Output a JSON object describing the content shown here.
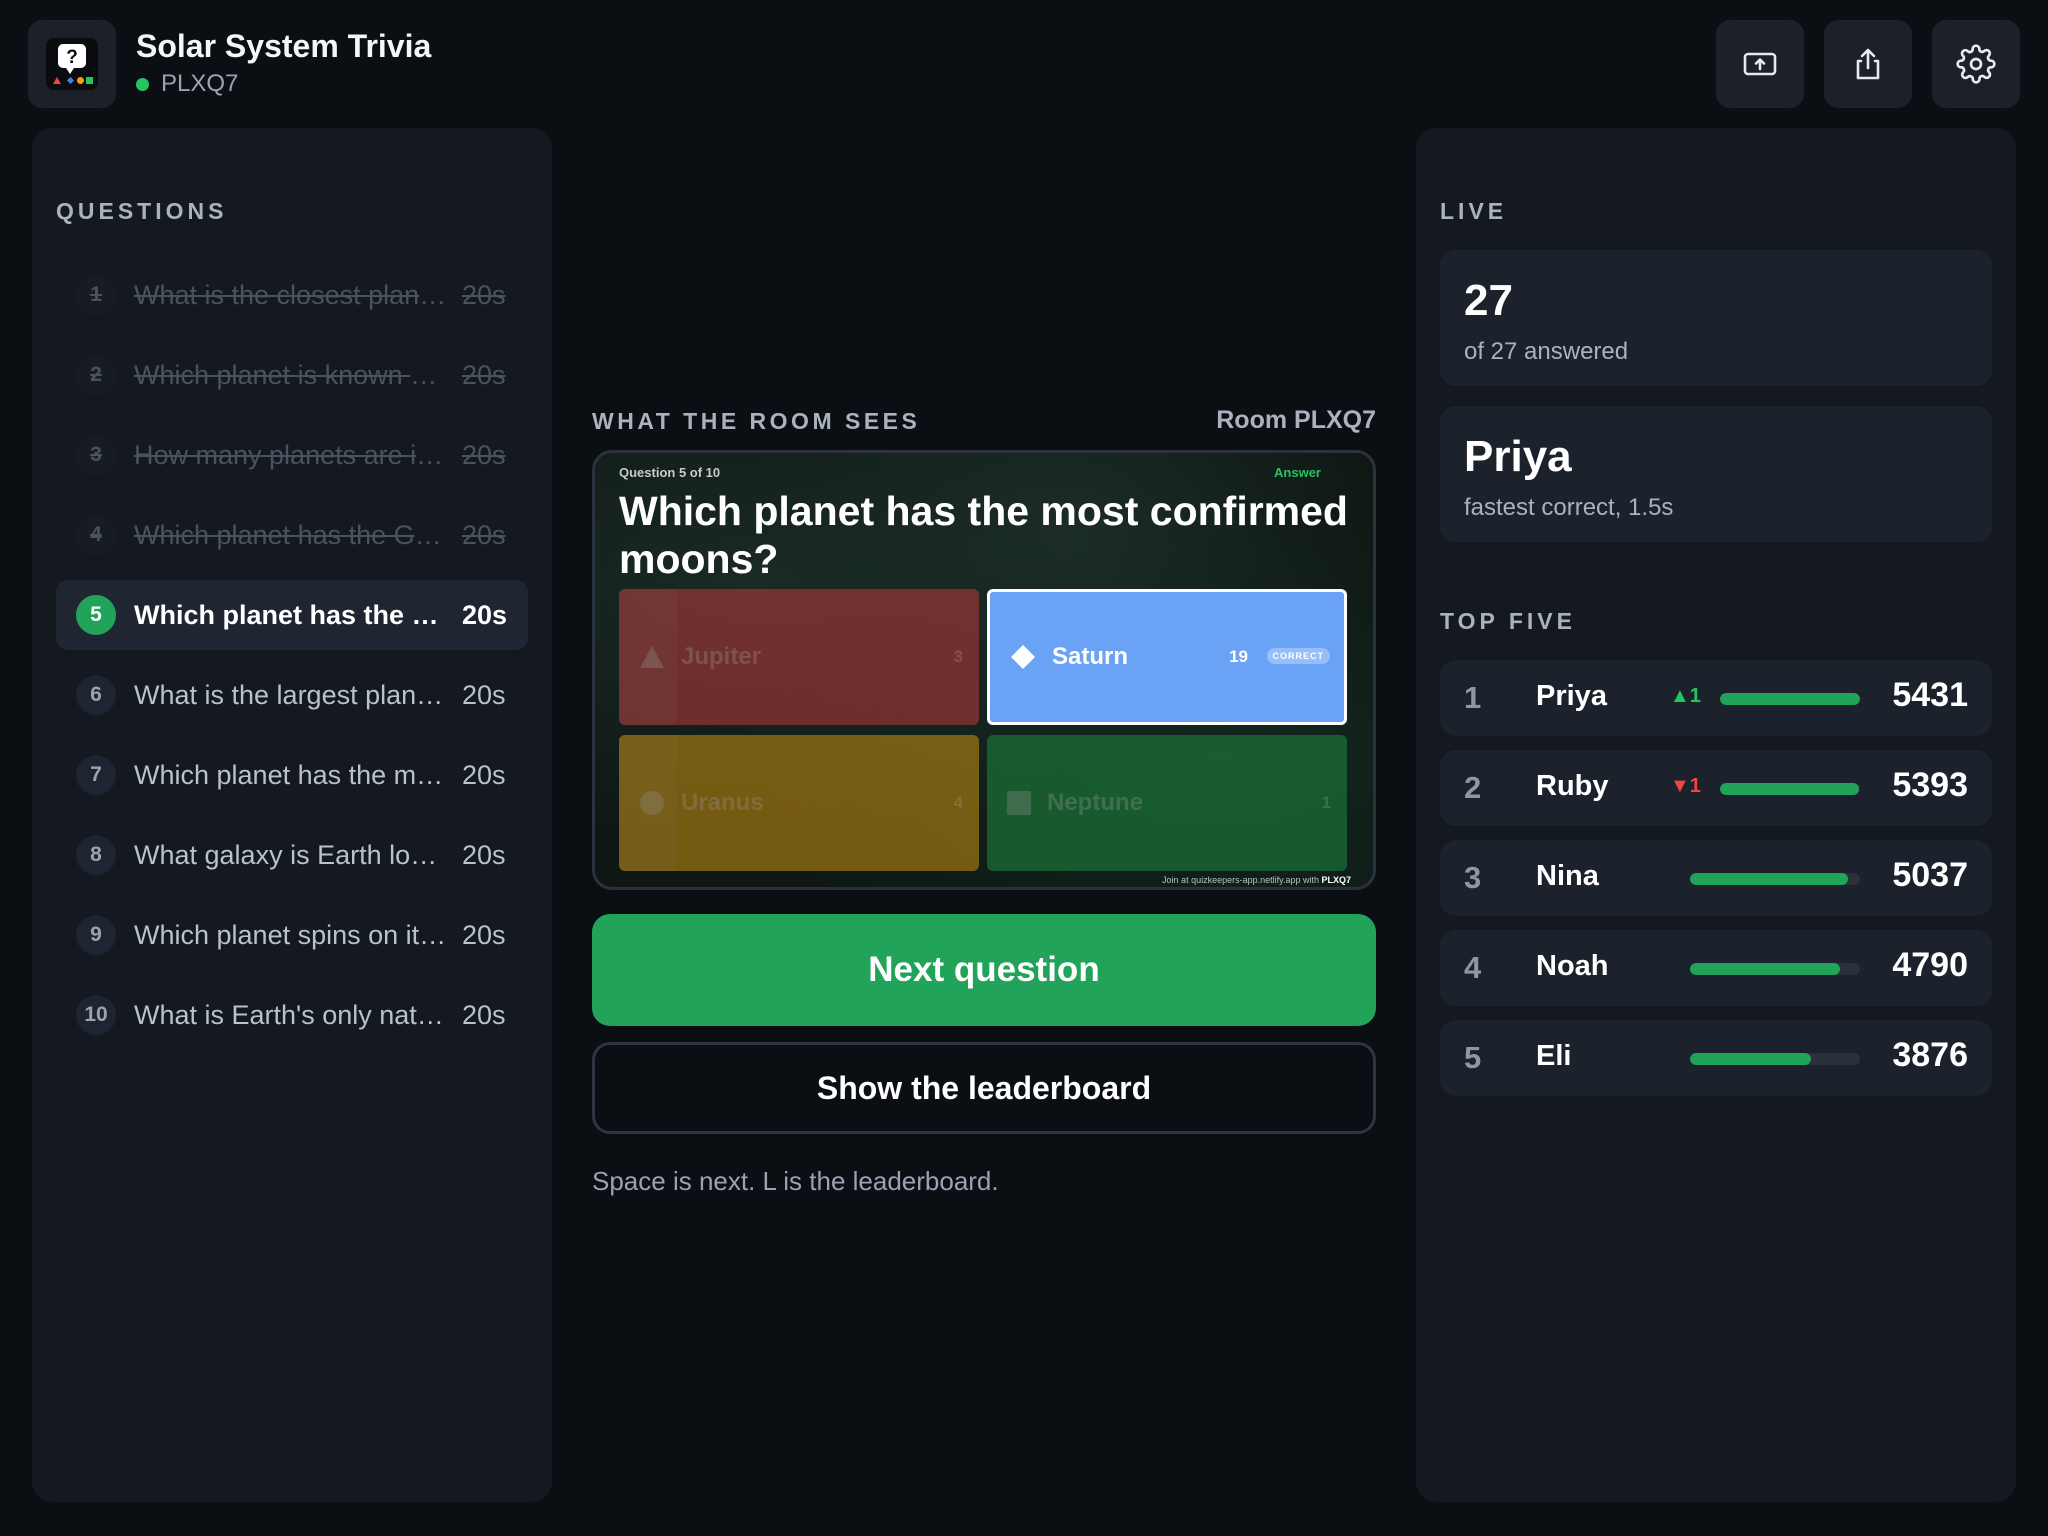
{
  "header": {
    "title": "Solar System Trivia",
    "room_code": "PLXQ7",
    "icons": [
      "cast-screen-icon",
      "share-icon",
      "settings-icon"
    ]
  },
  "questions": {
    "label": "QUESTIONS",
    "items": [
      {
        "num": "1",
        "text": "What is the closest planet to the Sun?",
        "time": "20s",
        "state": "done"
      },
      {
        "num": "2",
        "text": "Which planet is known as the Red Planet?",
        "time": "20s",
        "state": "done"
      },
      {
        "num": "3",
        "text": "How many planets are in our solar system?",
        "time": "20s",
        "state": "done"
      },
      {
        "num": "4",
        "text": "Which planet has the Great Red Spot?",
        "time": "20s",
        "state": "done"
      },
      {
        "num": "5",
        "text": "Which planet has the most confirmed moons?",
        "time": "20s",
        "state": "active"
      },
      {
        "num": "6",
        "text": "What is the largest planet in our solar system?",
        "time": "20s",
        "state": "upcoming"
      },
      {
        "num": "7",
        "text": "Which planet has the most visible rings?",
        "time": "20s",
        "state": "upcoming"
      },
      {
        "num": "8",
        "text": "What galaxy is Earth located in?",
        "time": "20s",
        "state": "upcoming"
      },
      {
        "num": "9",
        "text": "Which planet spins on its side?",
        "time": "20s",
        "state": "upcoming"
      },
      {
        "num": "10",
        "text": "What is Earth's only natural satellite?",
        "time": "20s",
        "state": "upcoming"
      }
    ]
  },
  "preview": {
    "label": "WHAT THE ROOM SEES",
    "room": "Room PLXQ7",
    "question_num": "Question 5 of 10",
    "answer_label": "Answer",
    "question": "Which planet has the most confirmed moons?",
    "answers": [
      {
        "label": "Jupiter",
        "count": "3",
        "shape": "triangle",
        "color": "#b83a3a"
      },
      {
        "label": "Saturn",
        "count": "19",
        "shape": "diamond",
        "color": "#6aa3f5",
        "correct": true,
        "badge": "CORRECT"
      },
      {
        "label": "Uranus",
        "count": "4",
        "shape": "circle",
        "color": "#c9900f"
      },
      {
        "label": "Neptune",
        "count": "1",
        "shape": "square",
        "color": "#1e8a3e"
      }
    ],
    "join_prefix": "Join at quizkeepers-app.netlify.app with ",
    "join_code": "PLXQ7"
  },
  "actions": {
    "next": "Next question",
    "leaderboard": "Show the leaderboard",
    "hint": "Space is next. L is the leaderboard."
  },
  "live": {
    "label": "LIVE",
    "answered_count": "27",
    "answered_sub": "of 27 answered",
    "fastest_name": "Priya",
    "fastest_sub": "fastest correct, 1.5s"
  },
  "top_five": {
    "label": "TOP FIVE",
    "rows": [
      {
        "rank": "1",
        "name": "Priya",
        "delta": "▲1",
        "dir": "up",
        "score": "5431",
        "fill": 1.0
      },
      {
        "rank": "2",
        "name": "Ruby",
        "delta": "▼1",
        "dir": "down",
        "score": "5393",
        "fill": 0.993
      },
      {
        "rank": "3",
        "name": "Nina",
        "delta": "",
        "dir": "",
        "score": "5037",
        "fill": 0.927
      },
      {
        "rank": "4",
        "name": "Noah",
        "delta": "",
        "dir": "",
        "score": "4790",
        "fill": 0.882
      },
      {
        "rank": "5",
        "name": "Eli",
        "delta": "",
        "dir": "",
        "score": "3876",
        "fill": 0.714
      }
    ]
  }
}
